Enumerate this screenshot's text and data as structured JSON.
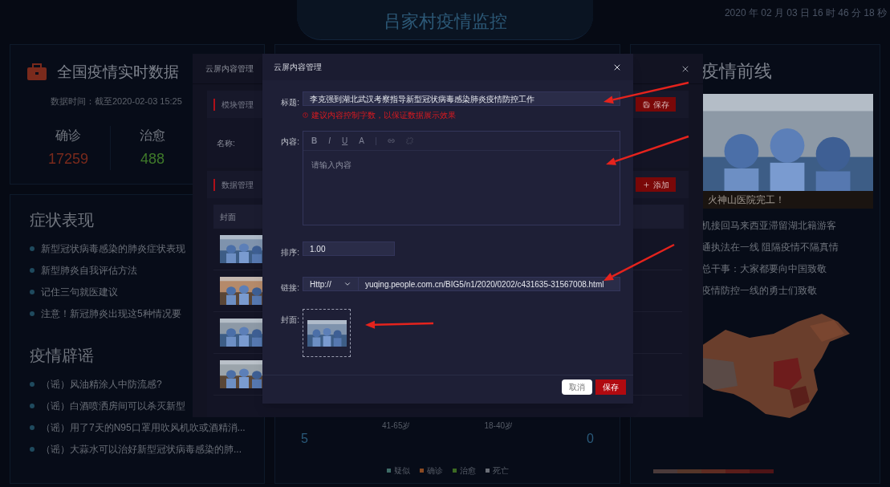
{
  "header": {
    "title": "吕家村疫情监控",
    "clock": "2020 年 02 月 03 日 16 时 46 分 18 秒"
  },
  "national": {
    "title": "全国疫情实时数据",
    "time": "数据时间：截至2020-02-03 15:25",
    "stats": [
      {
        "label": "确诊",
        "value": "17259",
        "color": "#7a2a1c"
      },
      {
        "label": "治愈",
        "value": "488",
        "color": "#3f7a2a"
      }
    ]
  },
  "symptoms": {
    "title": "症状表现",
    "items": [
      "新型冠状病毒感染的肺炎症状表现",
      "新型肺炎自我评估方法",
      "记住三句就医建议",
      "注意！新冠肺炎出现这5种情况要"
    ]
  },
  "rumors": {
    "title": "疫情辟谣",
    "items": [
      "（谣）风油精涂人中防流感?",
      "（谣）白酒喷洒房间可以杀灭新型",
      "（谣）用了7天的N95口罩用吹风机吹或酒精消...",
      "（谣）大蒜水可以治好新型冠状病毒感染的肺..."
    ]
  },
  "age_panel": {
    "left_value": "5",
    "right_value": "0",
    "ages": [
      "41-65岁",
      "18-40岁"
    ],
    "legend": [
      {
        "label": "疑似",
        "color": "#3e6b66"
      },
      {
        "label": "确诊",
        "color": "#8a4a22"
      },
      {
        "label": "治愈",
        "color": "#3c6a22"
      },
      {
        "label": "死亡",
        "color": "#6a6e76"
      }
    ]
  },
  "frontline": {
    "title": "疫情前线",
    "photo": {
      "kind": "picture",
      "caption": "火神山医院完工！"
    },
    "news": [
      "机接回马来西亚滞留湖北籍游客",
      "通执法在一线 阻隔疫情不隔真情",
      "总干事：大家都要向中国致敬",
      "疫情防控一线的勇士们致敬"
    ]
  },
  "back_dialog": {
    "title": "云屏内容管理",
    "sections": [
      {
        "title": "模块管理",
        "button": "保存",
        "kind": "save"
      },
      {
        "title": "数据管理",
        "button": "添加",
        "kind": "add"
      }
    ],
    "name_label": "名称:",
    "table": {
      "columns": [
        "封面"
      ],
      "rows": [
        {
          "cover": {
            "kind": "picture"
          }
        },
        {
          "cover": {
            "kind": "picture"
          }
        },
        {
          "cover": {
            "kind": "picture"
          }
        },
        {
          "cover": {
            "kind": "picture"
          }
        }
      ]
    }
  },
  "dialog": {
    "title": "云屏内容管理",
    "fields": [
      {
        "kind": "text",
        "label": "标题:",
        "value": "李克强到湖北武汉考察指导新型冠状病毒感染肺炎疫情防控工作",
        "error": "建议内容控制字数，以保证数据展示效果"
      },
      {
        "kind": "editor",
        "label": "内容:",
        "toolbar": [
          "B",
          "I",
          "U",
          "A"
        ],
        "placeholder": "请输入内容"
      },
      {
        "kind": "number",
        "label": "排序:",
        "value": "1.00"
      },
      {
        "kind": "link",
        "label": "链接:",
        "protocol": "Http://",
        "value": "yuqing.people.com.cn/BIG5/n1/2020/0202/c431635-31567008.html"
      },
      {
        "kind": "cover",
        "label": "封面:",
        "image": {
          "kind": "picture"
        }
      }
    ],
    "buttons": [
      {
        "label": "取消",
        "kind": "cancel"
      },
      {
        "label": "保存",
        "kind": "primary"
      }
    ]
  }
}
